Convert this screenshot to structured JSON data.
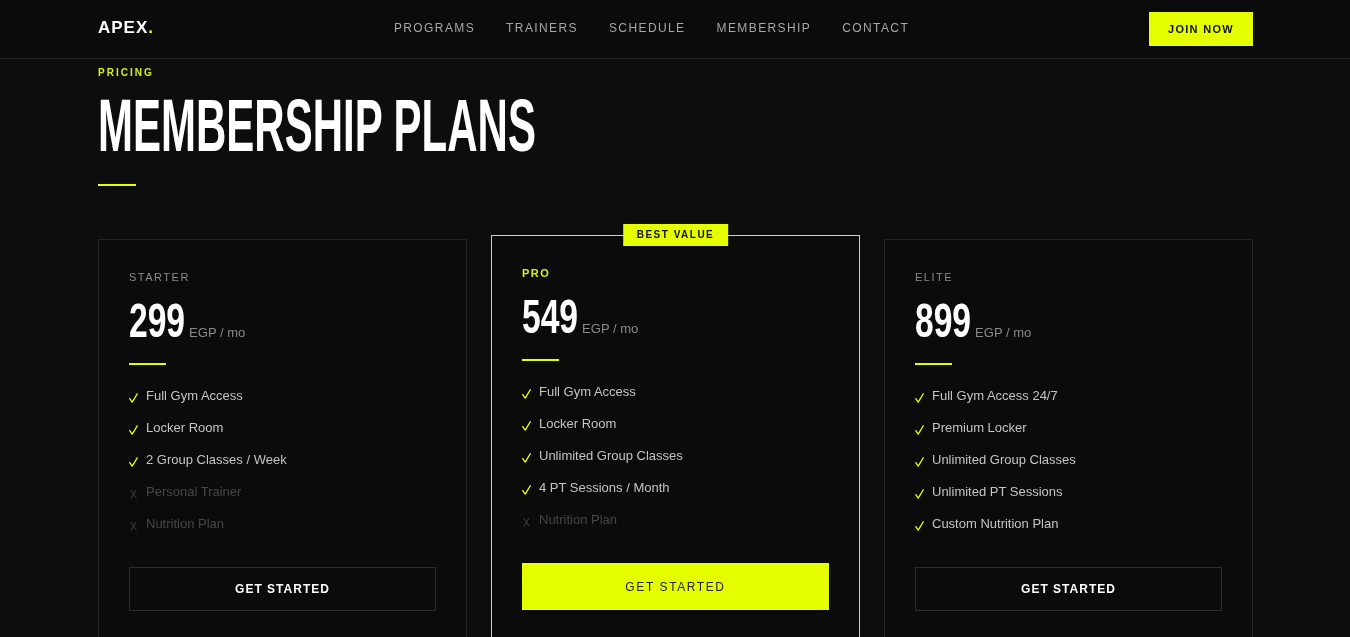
{
  "header": {
    "logo": {
      "text": "APEX",
      "accent": "."
    },
    "nav": [
      "PROGRAMS",
      "TRAINERS",
      "SCHEDULE",
      "MEMBERSHIP",
      "CONTACT"
    ],
    "cta": "JOIN NOW"
  },
  "section": {
    "eyebrow": "PRICING",
    "title": "MEMBERSHIP PLANS"
  },
  "plans": [
    {
      "tier": "STARTER",
      "featured": false,
      "price": "299",
      "unit": "EGP / mo",
      "features": [
        {
          "text": "Full Gym Access",
          "included": true
        },
        {
          "text": "Locker Room",
          "included": true
        },
        {
          "text": "2 Group Classes / Week",
          "included": true
        },
        {
          "text": "Personal Trainer",
          "included": false
        },
        {
          "text": "Nutrition Plan",
          "included": false
        }
      ],
      "button": "GET STARTED"
    },
    {
      "tier": "PRO",
      "featured": true,
      "badge": "BEST VALUE",
      "price": "549",
      "unit": "EGP / mo",
      "features": [
        {
          "text": "Full Gym Access",
          "included": true
        },
        {
          "text": "Locker Room",
          "included": true
        },
        {
          "text": "Unlimited Group Classes",
          "included": true
        },
        {
          "text": "4 PT Sessions / Month",
          "included": true
        },
        {
          "text": "Nutrition Plan",
          "included": false
        }
      ],
      "button": "GET STARTED"
    },
    {
      "tier": "ELITE",
      "featured": false,
      "price": "899",
      "unit": "EGP / mo",
      "features": [
        {
          "text": "Full Gym Access 24/7",
          "included": true
        },
        {
          "text": "Premium Locker",
          "included": true
        },
        {
          "text": "Unlimited Group Classes",
          "included": true
        },
        {
          "text": "Unlimited PT Sessions",
          "included": true
        },
        {
          "text": "Custom Nutrition Plan",
          "included": true
        }
      ],
      "button": "GET STARTED"
    }
  ]
}
